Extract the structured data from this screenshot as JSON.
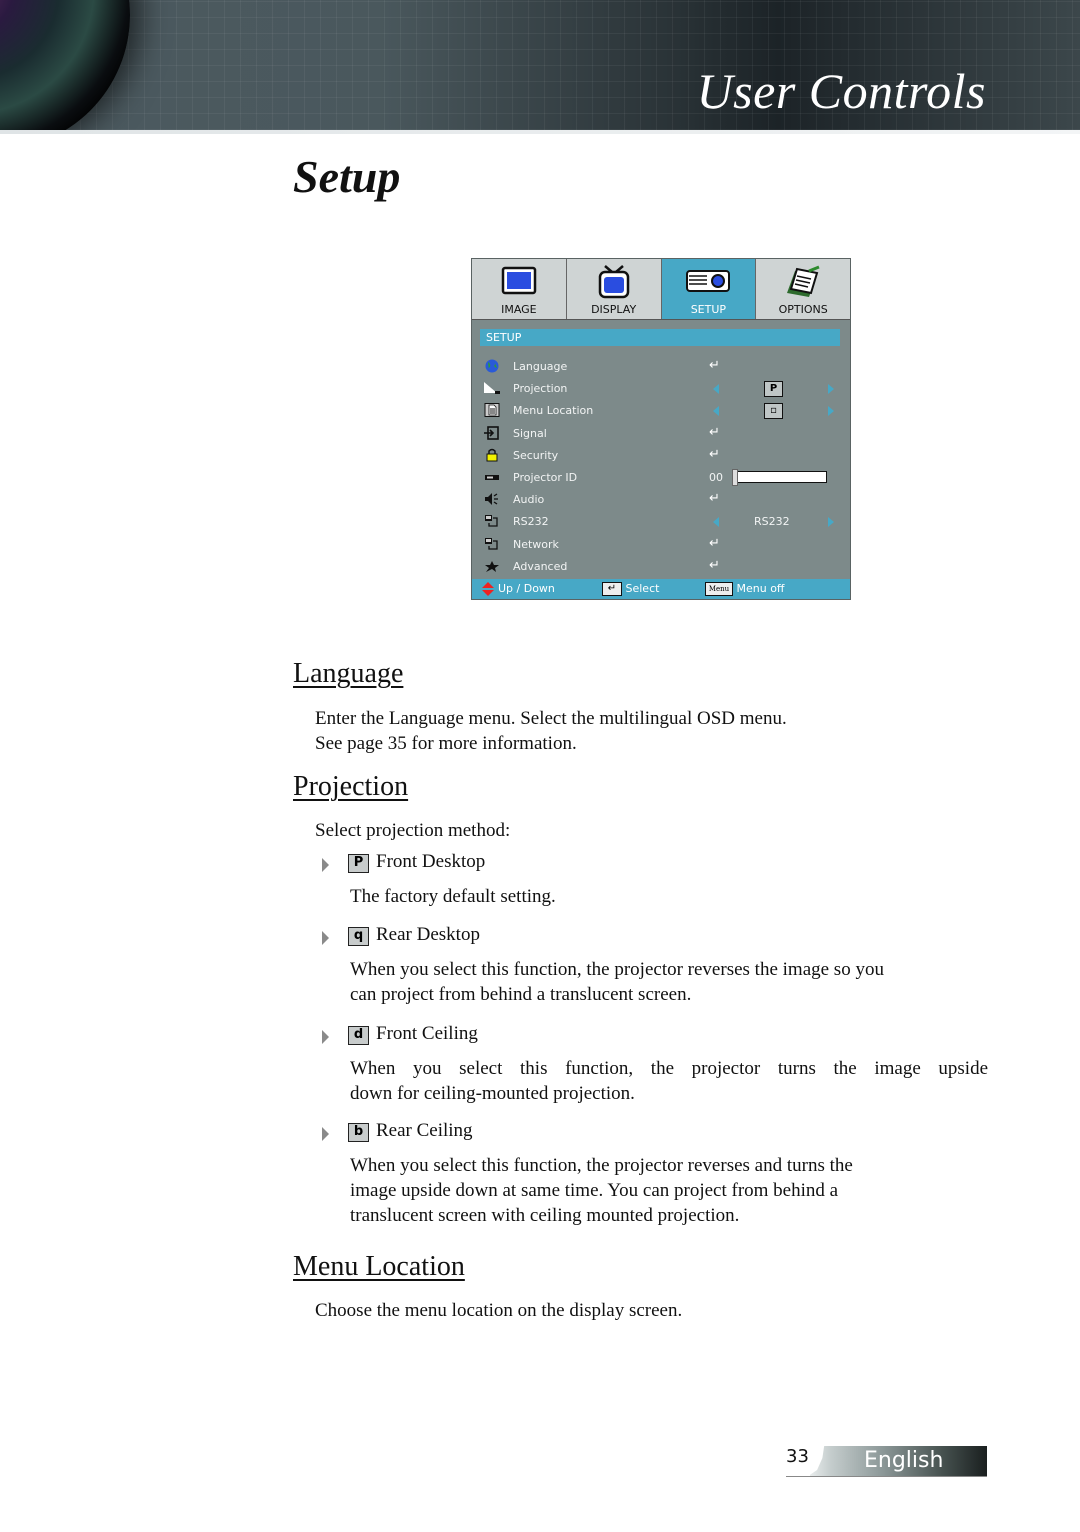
{
  "header": {
    "section_title": "User Controls"
  },
  "page": {
    "title": "Setup",
    "page_number": "33",
    "language": "English"
  },
  "osd": {
    "tabs": [
      {
        "label": "IMAGE",
        "icon": "monitor-icon",
        "active": false
      },
      {
        "label": "DISPLAY",
        "icon": "tv-icon",
        "active": false
      },
      {
        "label": "SETUP",
        "icon": "projector-icon",
        "active": true
      },
      {
        "label": "OPTIONS",
        "icon": "notepad-icon",
        "active": false
      }
    ],
    "section_header": "SETUP",
    "rows": [
      {
        "label": "Language",
        "icon": "globe-icon",
        "control": "enter",
        "enter_glyph": "↵"
      },
      {
        "label": "Projection",
        "icon": "projection-icon",
        "control": "arrows",
        "value": "P"
      },
      {
        "label": "Menu Location",
        "icon": "document-icon",
        "control": "arrows",
        "value": "▫"
      },
      {
        "label": "Signal",
        "icon": "signal-input-icon",
        "control": "enter",
        "enter_glyph": "↵"
      },
      {
        "label": "Security",
        "icon": "lock-icon",
        "control": "enter",
        "enter_glyph": "↵"
      },
      {
        "label": "Projector ID",
        "icon": "projector-id-icon",
        "control": "slider",
        "value": "00",
        "slider_fraction": 0.0
      },
      {
        "label": "Audio",
        "icon": "speaker-icon",
        "control": "enter",
        "enter_glyph": "↵"
      },
      {
        "label": "RS232",
        "icon": "network-icon",
        "control": "arrows",
        "value": "RS232"
      },
      {
        "label": "Network",
        "icon": "network-icon",
        "control": "enter",
        "enter_glyph": "↵"
      },
      {
        "label": "Advanced",
        "icon": "advanced-icon",
        "control": "enter",
        "enter_glyph": "↵"
      }
    ],
    "footer": {
      "updown_label": "Up / Down",
      "select_label": "Select",
      "select_glyph": "↵",
      "menu_key": "Menu",
      "menu_off_label": "Menu off"
    }
  },
  "sections": {
    "language": {
      "heading": "Language",
      "text_line1": "Enter the Language menu. Select the multilingual OSD menu.",
      "text_line2": "See page 35 for more information."
    },
    "projection": {
      "heading": "Projection",
      "intro": "Select projection method:",
      "options": [
        {
          "icon_glyph": "P",
          "label": "Front Desktop",
          "desc_lines": [
            "The factory default setting."
          ]
        },
        {
          "icon_glyph": "q",
          "label": "Rear Desktop",
          "desc_lines": [
            "When you select this function, the projector reverses the image so you",
            "can project from behind a translucent screen."
          ]
        },
        {
          "icon_glyph": "d",
          "label": "Front Ceiling",
          "desc_lines": [
            "When you select this function, the projector turns the image upside",
            "down for ceiling-mounted projection."
          ]
        },
        {
          "icon_glyph": "b",
          "label": "Rear Ceiling",
          "desc_lines": [
            "When you select this function, the projector reverses and turns the",
            "image upside down at same time. You can project from behind a",
            "translucent screen with ceiling mounted projection."
          ]
        }
      ]
    },
    "menu_location": {
      "heading": "Menu Location",
      "text": "Choose the menu location on the display screen."
    }
  },
  "colors": {
    "osd_accent": "#47a8c6",
    "osd_background": "#7d8a8a",
    "banner_dark": "#1c2327"
  }
}
